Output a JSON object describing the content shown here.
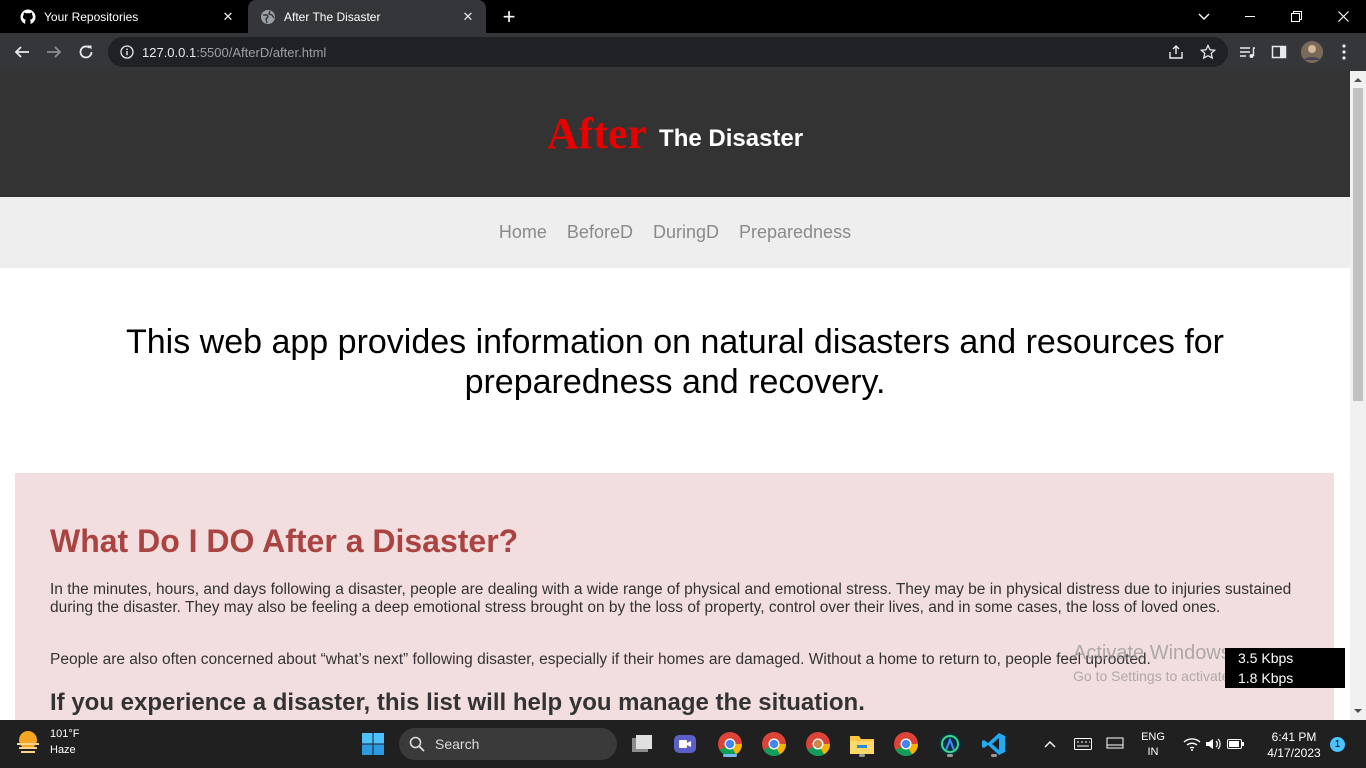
{
  "browser": {
    "tabs": [
      {
        "title": "Your Repositories",
        "icon": "github-icon"
      },
      {
        "title": "After The Disaster",
        "icon": "globe-icon",
        "active": true
      }
    ],
    "address": {
      "host": "127.0.0.1",
      "path": ":5500/AfterD/after.html"
    }
  },
  "site": {
    "brand_red": "After",
    "brand_white": "The Disaster",
    "nav": [
      "Home",
      "BeforeD",
      "DuringD",
      "Preparedness"
    ],
    "intro": "This web app provides information on natural disasters and resources for preparedness and recovery.",
    "section": {
      "heading": "What Do I DO After a Disaster?",
      "para1": "In the minutes, hours, and days following a disaster, people are dealing with a wide range of physical and emotional stress. They may be in physical distress due to injuries sustained during the disaster. They may also be feeling a deep emotional stress brought on by the loss of property, control over their lives, and in some cases, the loss of loved ones.",
      "para2": "People are also often concerned about “what’s next” following disaster, especially if their homes are damaged. Without a home to return to, people feel uprooted.",
      "subheading": "If you experience a disaster, this list will help you manage the situation."
    },
    "colors": {
      "brand_red": "#e60000",
      "header_bg": "#333333",
      "panel_bg": "#f2dede",
      "heading": "#a94442"
    }
  },
  "overlay": {
    "activate_title": "Activate Windows",
    "activate_sub": "Go to Settings to activate Windows.",
    "net_up": "3.5 Kbps",
    "net_down": "1.8 Kbps"
  },
  "taskbar": {
    "temperature": "101°F",
    "condition": "Haze",
    "search_label": "Search",
    "lang_top": "ENG",
    "lang_bottom": "IN",
    "time": "6:41 PM",
    "date": "4/17/2023",
    "notifications": "1"
  }
}
